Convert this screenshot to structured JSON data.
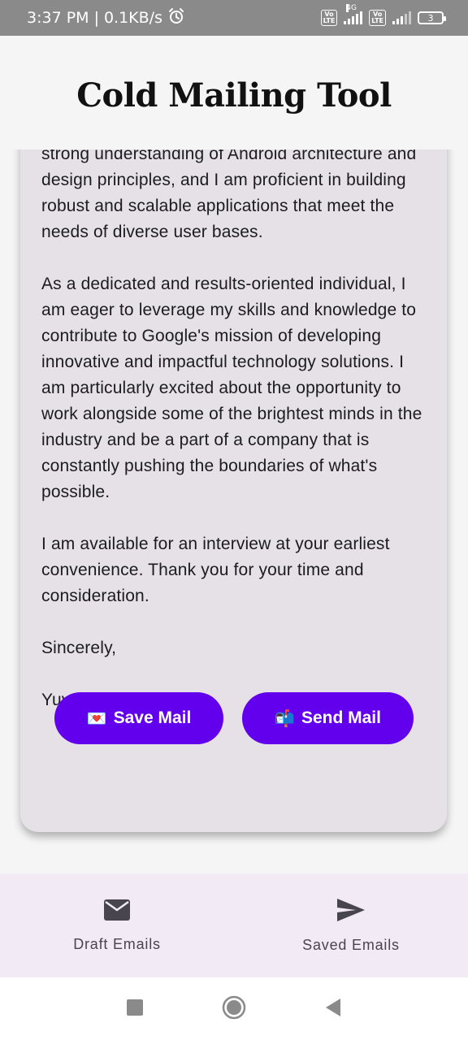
{
  "status_bar": {
    "time": "3:37 PM",
    "separator": "|",
    "speed": "0.1KB/s",
    "alarm_icon": "alarm-clock-icon",
    "volte_label": "Vo LTE",
    "network_label": "4G",
    "battery_level": "3"
  },
  "app": {
    "title": "Cold Mailing Tool"
  },
  "letter": {
    "paragraph_1": "strong understanding of Android architecture and design principles, and I am proficient in building robust and scalable applications that meet the needs of diverse user bases.",
    "paragraph_2": "As a dedicated and results-oriented individual, I am eager to leverage my skills and knowledge to contribute to Google's mission of developing innovative and impactful technology solutions. I am particularly excited about the opportunity to work alongside some of the brightest minds in the industry and be a part of a company that is constantly pushing the boundaries of what's possible.",
    "paragraph_3": "I am available for an interview at your earliest convenience. Thank you for your time and consideration.",
    "closing": "Sincerely,",
    "signature": "Yuvraj Singh"
  },
  "actions": {
    "save_label": "Save Mail",
    "save_emoji": "💌",
    "send_label": "Send Mail",
    "send_emoji": "📬"
  },
  "bottom_nav": {
    "draft_label": "Draft Emails",
    "draft_icon": "mail-icon",
    "saved_label": "Saved Emails",
    "saved_icon": "send-icon"
  },
  "system_nav": {
    "recents_icon": "square-recents-icon",
    "home_icon": "circle-home-icon",
    "back_icon": "triangle-back-icon"
  },
  "colors": {
    "primary": "#6200ee",
    "card": "#e6e1e6",
    "bottom_nav": "#f2ebf6",
    "status_bar": "#8a8a8a"
  }
}
